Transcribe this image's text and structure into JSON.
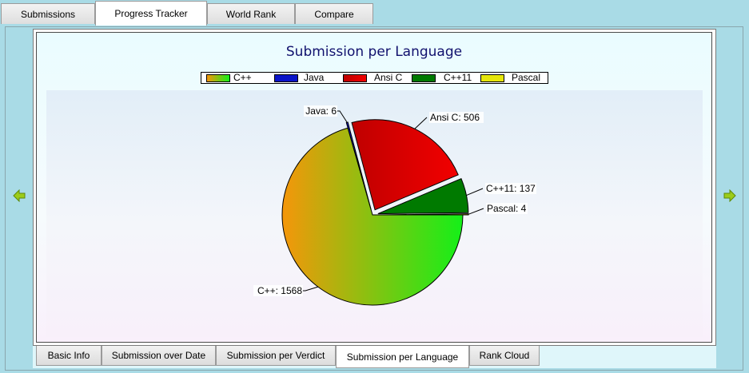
{
  "top_tabs": [
    {
      "label": "Submissions",
      "active": false
    },
    {
      "label": "Progress Tracker",
      "active": true
    },
    {
      "label": "World Rank",
      "active": false
    },
    {
      "label": "Compare",
      "active": false
    }
  ],
  "nav": {
    "prev_icon": "arrow-left-icon",
    "next_icon": "arrow-right-icon",
    "arrow_color": "#9ccc1a"
  },
  "bottom_tabs": [
    {
      "label": "Basic Info",
      "active": false
    },
    {
      "label": "Submission over Date",
      "active": false
    },
    {
      "label": "Submission per Verdict",
      "active": false
    },
    {
      "label": "Submission per Language",
      "active": true
    },
    {
      "label": "Rank Cloud",
      "active": false
    }
  ],
  "chart_data": {
    "type": "pie",
    "title": "Submission per Language",
    "legend_position": "top",
    "slices": [
      {
        "name": "C++",
        "value": 1568,
        "label": "C++: 1568",
        "color_from": "#f5960a",
        "color_to": "#14f018"
      },
      {
        "name": "Java",
        "value": 6,
        "label": "Java: 6",
        "color_from": "#0a14c8",
        "color_to": "#0a14c8"
      },
      {
        "name": "Ansi C",
        "value": 506,
        "label": "Ansi C: 506",
        "color_from": "#bf0000",
        "color_to": "#f20000"
      },
      {
        "name": "C++11",
        "value": 137,
        "label": "C++11: 137",
        "color_from": "#007a00",
        "color_to": "#007a00"
      },
      {
        "name": "Pascal",
        "value": 4,
        "label": "Pascal: 4",
        "color_from": "#e6e60a",
        "color_to": "#e6e60a"
      }
    ]
  }
}
